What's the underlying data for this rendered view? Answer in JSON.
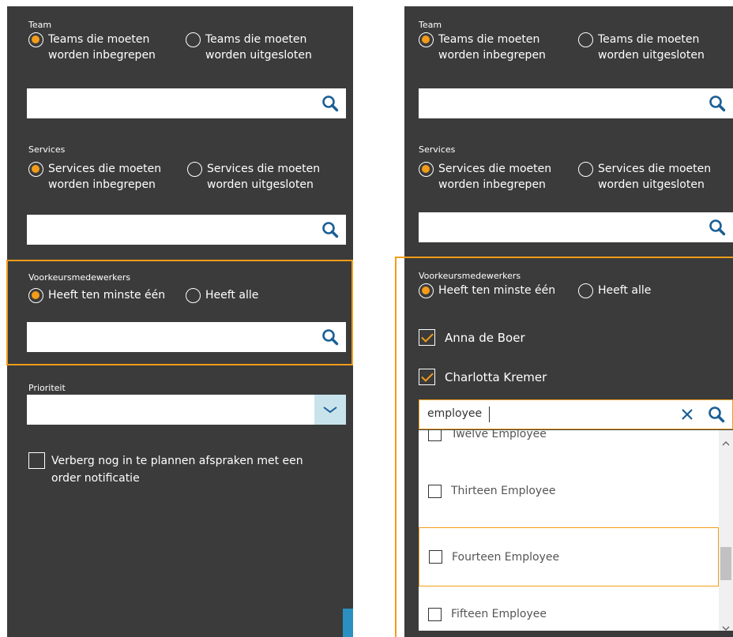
{
  "left": {
    "team": {
      "label": "Team",
      "include_line1": "Teams die moeten",
      "include_line2": "worden inbegrepen",
      "exclude_line1": "Teams die moeten",
      "exclude_line2": "worden uitgesloten",
      "search_value": ""
    },
    "services": {
      "label": "Services",
      "include_line1": "Services die moeten",
      "include_line2": "worden inbegrepen",
      "exclude_line1": "Services die moeten",
      "exclude_line2": "worden uitgesloten",
      "search_value": ""
    },
    "preferred": {
      "label": "Voorkeursmedewerkers",
      "at_least_one": "Heeft ten minste één",
      "all": "Heeft alle",
      "search_value": ""
    },
    "priority": {
      "label": "Prioriteit",
      "selected": ""
    },
    "hide_checkbox": {
      "line1": "Verberg nog in te plannen afspraken met een",
      "line2": "order notificatie"
    }
  },
  "right": {
    "team": {
      "label": "Team",
      "include_line1": "Teams die moeten",
      "include_line2": "worden inbegrepen",
      "exclude_line1": "Teams die moeten",
      "exclude_line2": "worden uitgesloten"
    },
    "services": {
      "label": "Services",
      "include_line1": "Services die moeten",
      "include_line2": "worden inbegrepen",
      "exclude_line1": "Services die moeten",
      "exclude_line2": "worden uitgesloten"
    },
    "preferred": {
      "label": "Voorkeursmedewerkers",
      "at_least_one": "Heeft ten minste één",
      "all": "Heeft alle",
      "selected": [
        "Anna de Boer",
        "Charlotta Kremer"
      ],
      "search_value": "employee",
      "results": [
        "Twelve Employee",
        "Thirteen Employee",
        "Fourteen Employee",
        "Fifteen Employee"
      ]
    }
  },
  "colors": {
    "panel_bg": "#3b3b3b",
    "accent": "#f39c1a",
    "icon_blue": "#1a5f96",
    "select_arrow_bg": "#c9e3ec"
  }
}
